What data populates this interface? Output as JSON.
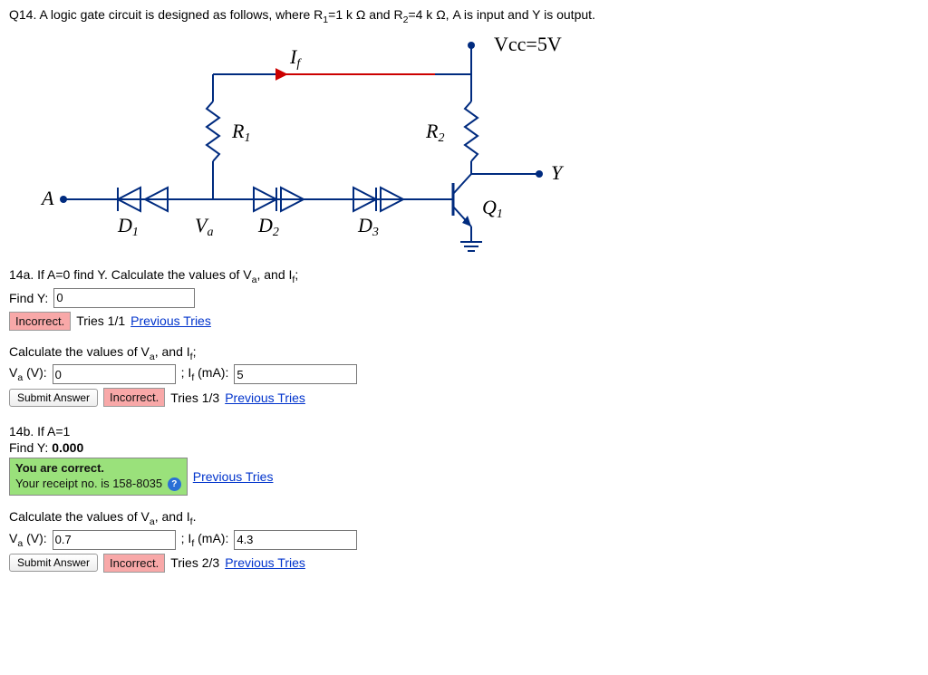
{
  "question": {
    "prefix": "Q14. A logic gate circuit is designed as follows, where R",
    "r1sub": "1",
    "mid1": "=1 k Ω and R",
    "r2sub": "2",
    "mid2": "=4 k Ω, A is input and Y is output."
  },
  "diagram": {
    "If": "I",
    "If_sub": "f",
    "Vcc": "Vcc=5V",
    "R1": "R",
    "R1_sub": "1",
    "R2": "R",
    "R2_sub": "2",
    "Y": "Y",
    "A": "A",
    "D1": "D",
    "D1_sub": "1",
    "Va": "V",
    "Va_sub": "a",
    "D2": "D",
    "D2_sub": "2",
    "D3": "D",
    "D3_sub": "3",
    "Q1": "Q",
    "Q1_sub": "1"
  },
  "part_a": {
    "heading1": "14a. If A=0 find Y. Calculate the values of V",
    "heading1_sub": "a",
    "heading1_tail": ", and I",
    "heading1_sub2": "f",
    "heading1_end": ";",
    "findY_label": "Find Y:",
    "findY_value": "0",
    "incorrect": "Incorrect.",
    "tries1": "Tries 1/1",
    "prev": "Previous Tries",
    "calc_head": "Calculate the values of V",
    "calc_sub": "a",
    "calc_mid": ", and I",
    "calc_sub2": "f",
    "calc_end": ";",
    "Va_label_pre": "V",
    "Va_label_sub": "a",
    "Va_label_post": " (V):",
    "Va_value": "0",
    "If_label_pre": "; I",
    "If_label_sub": "f",
    "If_label_post": " (mA):",
    "If_value": "5",
    "submit": "Submit Answer",
    "incorrect2": "Incorrect.",
    "tries2": "Tries 1/3",
    "prev2": "Previous Tries"
  },
  "part_b": {
    "heading": "14b. If A=1",
    "findY_label": "Find Y:",
    "findY_value": "0.000",
    "correct_l1": "You are correct.",
    "correct_l2": "Your receipt no. is 158-8035",
    "help": "?",
    "prev": "Previous Tries",
    "calc_head": "Calculate the values of V",
    "calc_sub": "a",
    "calc_mid": ", and I",
    "calc_sub2": "f",
    "calc_end": ".",
    "Va_label_pre": "V",
    "Va_label_sub": "a",
    "Va_label_post": " (V):",
    "Va_value": "0.7",
    "If_label_pre": "; I",
    "If_label_sub": "f",
    "If_label_post": " (mA):",
    "If_value": "4.3",
    "submit": "Submit Answer",
    "incorrect": "Incorrect.",
    "tries": "Tries 2/3",
    "prev2": "Previous Tries"
  }
}
